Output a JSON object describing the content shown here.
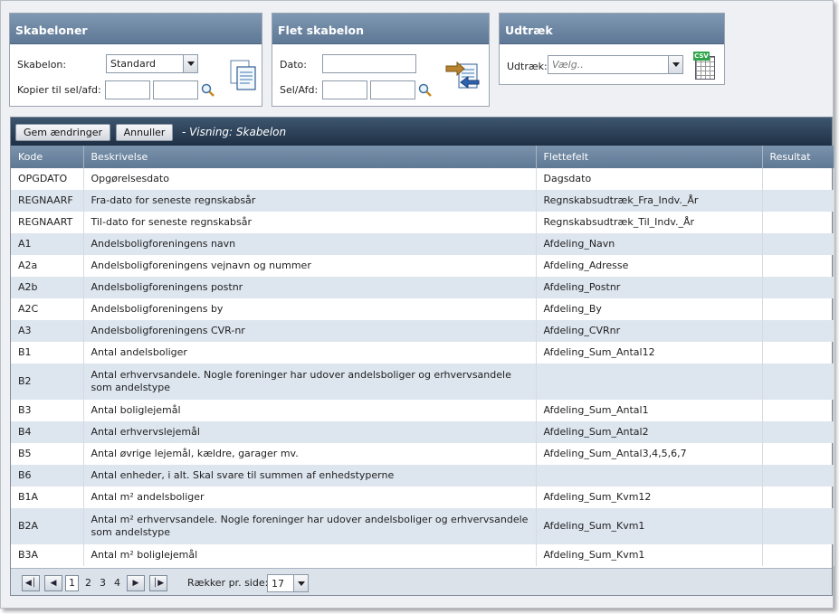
{
  "skab": {
    "title": "Skabeloner",
    "label_skabelon": "Skabelon:",
    "value": "Standard",
    "label_kopier": "Kopier til sel/afd:"
  },
  "flet": {
    "title": "Flet skabelon",
    "label_dato": "Dato:",
    "label_selafd": "Sel/Afd:"
  },
  "udtraek": {
    "title": "Udtræk",
    "label": "Udtræk:",
    "placeholder": "Vælg..",
    "csv_label": "CSV"
  },
  "toolbar": {
    "save": "Gem ændringer",
    "cancel": "Annuller",
    "view": "- Visning: Skabelon"
  },
  "columns": [
    "Kode",
    "Beskrivelse",
    "Flettefelt",
    "Resultat"
  ],
  "rows": [
    {
      "kode": "OPGDATO",
      "beskrivelse": "Opgørelsesdato",
      "flettefelt": "Dagsdato"
    },
    {
      "kode": "REGNAARF",
      "beskrivelse": "Fra-dato for seneste regnskabsår",
      "flettefelt": "Regnskabsudtræk_Fra_Indv._År"
    },
    {
      "kode": "REGNAART",
      "beskrivelse": "Til-dato for seneste regnskabsår",
      "flettefelt": "Regnskabsudtræk_Til_Indv._År"
    },
    {
      "kode": "A1",
      "beskrivelse": "Andelsboligforeningens navn",
      "flettefelt": "Afdeling_Navn"
    },
    {
      "kode": "A2a",
      "beskrivelse": "Andelsboligforeningens vejnavn og nummer",
      "flettefelt": "Afdeling_Adresse"
    },
    {
      "kode": "A2b",
      "beskrivelse": "Andelsboligforeningens postnr",
      "flettefelt": "Afdeling_Postnr"
    },
    {
      "kode": "A2C",
      "beskrivelse": "Andelsboligforeningens by",
      "flettefelt": "Afdeling_By"
    },
    {
      "kode": "A3",
      "beskrivelse": "Andelsboligforeningens CVR-nr",
      "flettefelt": "Afdeling_CVRnr"
    },
    {
      "kode": "B1",
      "beskrivelse": "Antal andelsboliger",
      "flettefelt": "Afdeling_Sum_Antal12"
    },
    {
      "kode": "B2",
      "beskrivelse": "Antal erhvervsandele. Nogle foreninger har udover andelsboliger og erhvervsandele som andelstype",
      "flettefelt": ""
    },
    {
      "kode": "B3",
      "beskrivelse": "Antal boliglejemål",
      "flettefelt": "Afdeling_Sum_Antal1"
    },
    {
      "kode": "B4",
      "beskrivelse": "Antal erhvervslejemål",
      "flettefelt": "Afdeling_Sum_Antal2"
    },
    {
      "kode": "B5",
      "beskrivelse": "Antal øvrige lejemål, kældre, garager mv.",
      "flettefelt": "Afdeling_Sum_Antal3,4,5,6,7"
    },
    {
      "kode": "B6",
      "beskrivelse": "Antal enheder, i alt. Skal svare til summen af enhedstyperne",
      "flettefelt": ""
    },
    {
      "kode": "B1A",
      "beskrivelse": "Antal m² andelsboliger",
      "flettefelt": "Afdeling_Sum_Kvm12"
    },
    {
      "kode": "B2A",
      "beskrivelse": "Antal m² erhvervsandele. Nogle foreninger har udover andelsboliger og erhvervsandele som andelstype",
      "flettefelt": "Afdeling_Sum_Kvm1"
    },
    {
      "kode": "B3A",
      "beskrivelse": "Antal m² boliglejemål",
      "flettefelt": "Afdeling_Sum_Kvm1"
    }
  ],
  "pager": {
    "pages": [
      "1",
      "2",
      "3",
      "4"
    ],
    "current": "1",
    "rows_label": "Rækker pr. side:",
    "rows_value": "17"
  }
}
